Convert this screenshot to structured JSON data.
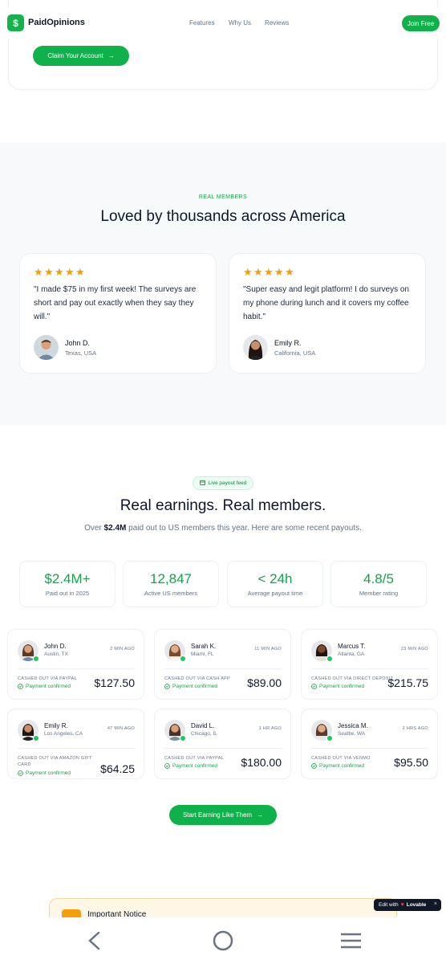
{
  "nav": {
    "logo_glyph": "$",
    "brand": "PaidOpinions",
    "links": [
      "Features",
      "Why Us",
      "Reviews"
    ],
    "join": "Join Free"
  },
  "hero": {
    "claim": "Claim Your Account"
  },
  "reviews": {
    "eyebrow": "REAL MEMBERS",
    "title": "Loved by thousands across America",
    "items": [
      {
        "quote": "\"I made $75 in my first week! The surveys are short and pay out exactly when they say they will.\"",
        "name": "John D.",
        "location": "Texas, USA",
        "stars": 5
      },
      {
        "quote": "\"Super easy and legit platform! I do surveys on my phone during lunch and it covers my coffee habit.\"",
        "name": "Emily R.",
        "location": "California, USA",
        "stars": 5
      }
    ]
  },
  "earnings": {
    "pill": "Live payout feed",
    "title": "Real earnings. Real members.",
    "subtitle_pre": "Over ",
    "subtitle_bold": "$2.4M",
    "subtitle_post": " paid out to US members this year. Here are some recent payouts.",
    "stats": [
      {
        "value": "$2.4M+",
        "label": "Paid out in 2025"
      },
      {
        "value": "12,847",
        "label": "Active US members"
      },
      {
        "value": "< 24h",
        "label": "Average payout time"
      },
      {
        "value": "4.8/5",
        "label": "Member rating"
      }
    ],
    "payouts": [
      {
        "name": "John D.",
        "city": "Austin, TX",
        "time": "2 MIN AGO",
        "method": "CASHED OUT VIA PAYPAL",
        "status": "Payment confirmed",
        "amount": "$127.50"
      },
      {
        "name": "Sarah K.",
        "city": "Miami, FL",
        "time": "11 MIN AGO",
        "method": "CASHED OUT VIA CASH APP",
        "status": "Payment confirmed",
        "amount": "$89.00"
      },
      {
        "name": "Marcus T.",
        "city": "Atlanta, GA",
        "time": "23 MIN AGO",
        "method": "CASHED OUT VIA DIRECT DEPOSIT",
        "status": "Payment confirmed",
        "amount": "$215.75"
      },
      {
        "name": "Emily R.",
        "city": "Los Angeles, CA",
        "time": "47 MIN AGO",
        "method": "CASHED OUT VIA AMAZON GIFT CARD",
        "status": "Payment confirmed",
        "amount": "$64.25"
      },
      {
        "name": "David L.",
        "city": "Chicago, IL",
        "time": "1 HR AGO",
        "method": "CASHED OUT VIA PAYPAL",
        "status": "Payment confirmed",
        "amount": "$180.00"
      },
      {
        "name": "Jessica M.",
        "city": "Seattle, WA",
        "time": "2 HRS AGO",
        "method": "CASHED OUT VIA VENMO",
        "status": "Payment confirmed",
        "amount": "$95.50"
      }
    ],
    "cta": "Start Earning Like Them"
  },
  "notice": {
    "title": "Important Notice"
  },
  "badge": {
    "edit_with": "Edit with",
    "brand": "Lovable",
    "close": "×"
  },
  "colors": {
    "accent": "#0fb14a",
    "star": "#f59e0b",
    "green_text": "#16a34a"
  }
}
